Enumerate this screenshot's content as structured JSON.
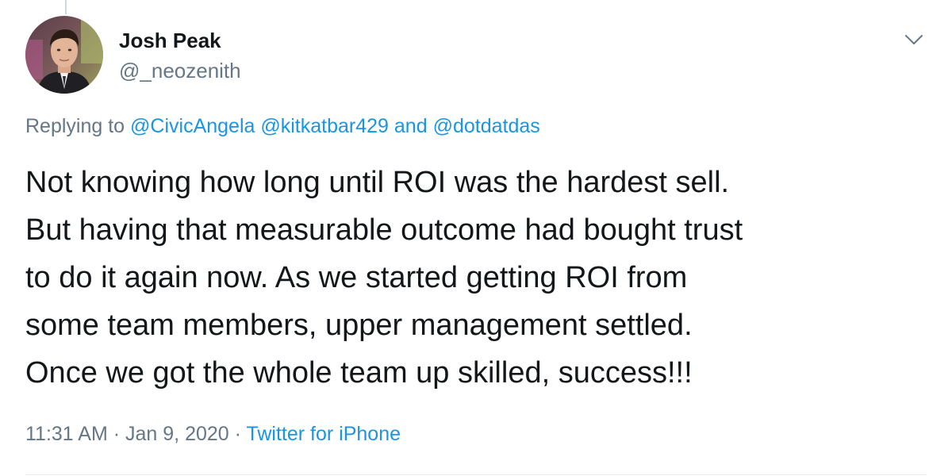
{
  "tweet": {
    "author": {
      "display_name": "Josh Peak",
      "handle": "@_neozenith"
    },
    "menu_icon": "chevron-down-icon",
    "replying": {
      "prefix": "Replying to",
      "mention_1": "@CivicAngela",
      "mention_2": "@kitkatbar429",
      "conjunction": "and",
      "mention_3": "@dotdatdas"
    },
    "body_lines": [
      "Not knowing how long until ROI was the hardest sell.",
      "But having that measurable outcome had bought trust",
      "to do it again now. As we started getting ROI from",
      "some team members, upper management settled.",
      "Once we got the whole team up skilled, success!!!"
    ],
    "meta": {
      "time": "11:31 AM",
      "date": "Jan 9, 2020",
      "separator": "·",
      "source": "Twitter for iPhone"
    }
  },
  "colors": {
    "text_primary": "#14171a",
    "text_secondary": "#657786",
    "link": "#1b95e0",
    "divider": "#e6ecf0"
  }
}
